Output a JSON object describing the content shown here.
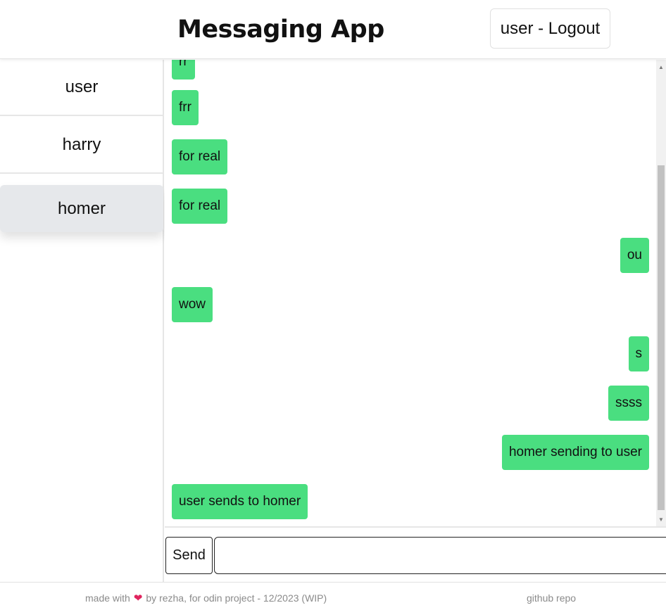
{
  "header": {
    "title": "Messaging App",
    "logout_label": "user - Logout"
  },
  "sidebar": {
    "contacts": [
      {
        "label": "user"
      },
      {
        "label": "harry"
      },
      {
        "label": "homer",
        "active": true
      }
    ]
  },
  "messages": [
    {
      "text": "rr",
      "side": "left"
    },
    {
      "text": "frr",
      "side": "left"
    },
    {
      "text": "for real",
      "side": "left"
    },
    {
      "text": "for real",
      "side": "left"
    },
    {
      "text": "ou",
      "side": "right"
    },
    {
      "text": "wow",
      "side": "left"
    },
    {
      "text": "s",
      "side": "right"
    },
    {
      "text": "ssss",
      "side": "right"
    },
    {
      "text": "homer sending to user",
      "side": "right"
    },
    {
      "text": "user sends to homer",
      "side": "left"
    }
  ],
  "composer": {
    "send_label": "Send",
    "input_value": "",
    "input_placeholder": ""
  },
  "footer": {
    "made_with_prefix": "made with",
    "made_with_suffix": "by rezha, for odin project - 12/2023 (WIP)",
    "repo_link": "github repo"
  },
  "colors": {
    "bubble": "#4ade80",
    "active_contact": "#e6e8eb",
    "heart": "#e0245e"
  },
  "icons": {
    "heart": "heart-icon",
    "scroll_up": "chevron-up-icon",
    "scroll_down": "chevron-down-icon"
  }
}
